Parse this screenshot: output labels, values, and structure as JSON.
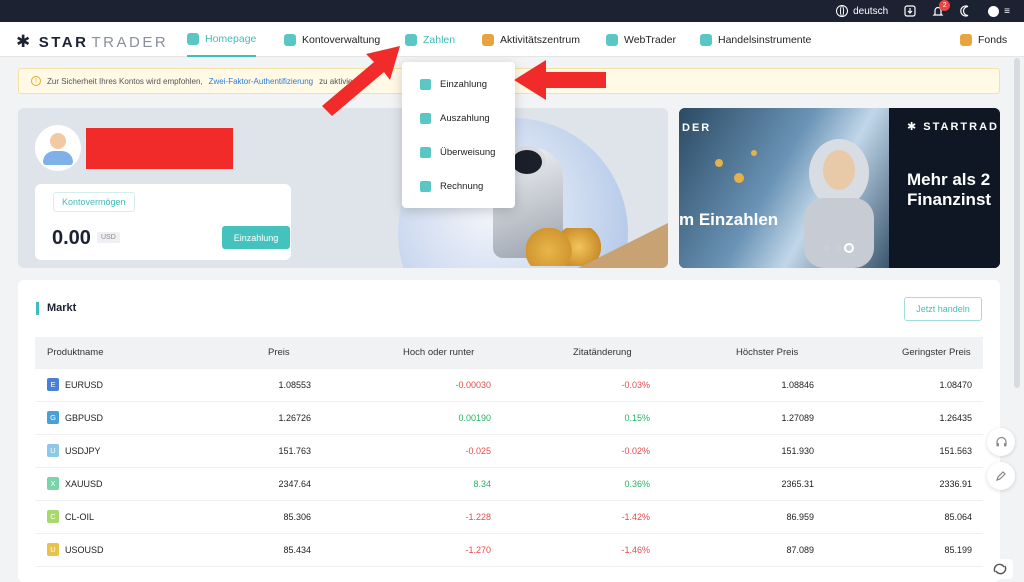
{
  "topbar": {
    "language": "deutsch",
    "notification_count": "2",
    "menu_label": "≡"
  },
  "brand": {
    "bold": "STAR",
    "light": "TRADER"
  },
  "nav": {
    "items": [
      {
        "label": "Homepage"
      },
      {
        "label": "Kontoverwaltung"
      },
      {
        "label": "Zahlen"
      },
      {
        "label": "Aktivitätszentrum"
      },
      {
        "label": "WebTrader"
      },
      {
        "label": "Handelsinstrumente"
      },
      {
        "label": "Fonds"
      }
    ]
  },
  "notice": {
    "text_before": "Zur Sicherheit Ihres Kontos wird empfohlen,",
    "link": "Zwei-Faktor-Authentifizierung",
    "text_after": "zu aktivieren"
  },
  "dropdown": {
    "items": [
      {
        "label": "Einzahlung"
      },
      {
        "label": "Auszahlung"
      },
      {
        "label": "Überweisung"
      },
      {
        "label": "Rechnung"
      }
    ]
  },
  "account": {
    "balance_label": "Kontovermögen",
    "amount": "0.00",
    "currency": "USD",
    "deposit_button": "Einzahlung"
  },
  "banner": {
    "left_top": "DER",
    "left_main": "m Einzahlen",
    "brand": "✱ STARTRAD",
    "right_line1": "Mehr als 2",
    "right_line2": "Finanzinst"
  },
  "market": {
    "title": "Markt",
    "trade_button": "Jetzt handeln",
    "headers": {
      "name": "Produktname",
      "price": "Preis",
      "change": "Hoch oder runter",
      "pct": "Zitatänderung",
      "high": "Höchster Preis",
      "low": "Geringster Preis"
    },
    "rows": [
      {
        "letter": "E",
        "color": "#4a7fd6",
        "name": "EURUSD",
        "price": "1.08553",
        "change": "-0.00030",
        "pct": "-0.03%",
        "high": "1.08846",
        "low": "1.08470",
        "dir": "neg"
      },
      {
        "letter": "G",
        "color": "#4aa0d6",
        "name": "GBPUSD",
        "price": "1.26726",
        "change": "0.00190",
        "pct": "0.15%",
        "high": "1.27089",
        "low": "1.26435",
        "dir": "pos"
      },
      {
        "letter": "U",
        "color": "#8fc7e8",
        "name": "USDJPY",
        "price": "151.763",
        "change": "-0.025",
        "pct": "-0.02%",
        "high": "151.930",
        "low": "151.563",
        "dir": "neg"
      },
      {
        "letter": "X",
        "color": "#7bd3a8",
        "name": "XAUUSD",
        "price": "2347.64",
        "change": "8.34",
        "pct": "0.36%",
        "high": "2365.31",
        "low": "2336.91",
        "dir": "pos"
      },
      {
        "letter": "C",
        "color": "#a9d86a",
        "name": "CL-OIL",
        "price": "85.306",
        "change": "-1.228",
        "pct": "-1.42%",
        "high": "86.959",
        "low": "85.064",
        "dir": "neg"
      },
      {
        "letter": "U",
        "color": "#e8c24a",
        "name": "USOUSD",
        "price": "85.434",
        "change": "-1.270",
        "pct": "-1.46%",
        "high": "87.089",
        "low": "85.199",
        "dir": "neg"
      }
    ]
  },
  "colors": {
    "accent": "#3fbdb9",
    "topbar": "#1d2233",
    "negative": "#e54b4b",
    "positive": "#27b361",
    "annotation_arrow": "#f12a2a"
  }
}
